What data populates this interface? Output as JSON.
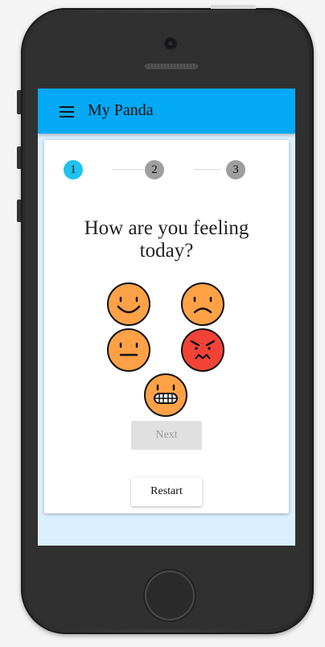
{
  "app": {
    "title": "My Panda"
  },
  "stepper": {
    "steps": [
      {
        "label": "1",
        "state": "active"
      },
      {
        "label": "2",
        "state": "inactive"
      },
      {
        "label": "3",
        "state": "inactive"
      }
    ]
  },
  "main": {
    "question": "How are you feeling today?",
    "moods": [
      "happy",
      "sad",
      "neutral",
      "angry",
      "grimacing"
    ]
  },
  "actions": {
    "next_label": "Next",
    "next_disabled": true,
    "restart_label": "Restart"
  },
  "colors": {
    "appbar": "#03a9f4",
    "active_step": "#1ec3ef",
    "face": "#ffa146",
    "angry_face": "#f44336"
  }
}
